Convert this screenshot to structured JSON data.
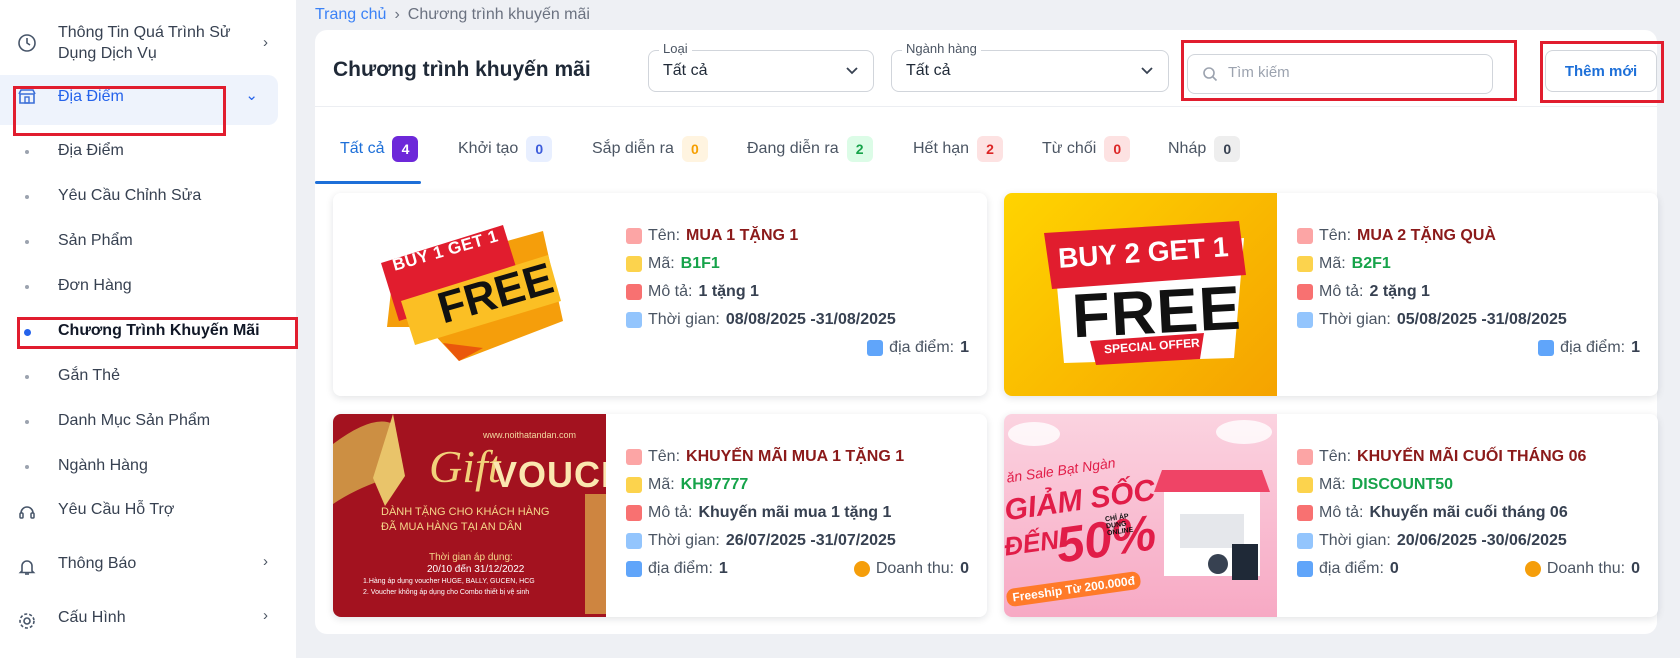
{
  "sidebar": {
    "items": [
      {
        "label_line1": "Thông Tin Quá Trình Sử",
        "label_line2": "Dụng Dịch Vụ",
        "icon": "clock-icon"
      },
      {
        "label": "Địa Điểm",
        "icon": "store-icon"
      },
      {
        "label": "Địa Điểm"
      },
      {
        "label": "Yêu Cầu Chỉnh Sửa"
      },
      {
        "label": "Sản Phẩm"
      },
      {
        "label": "Đơn Hàng"
      },
      {
        "label": "Chương Trình Khuyến Mãi"
      },
      {
        "label": "Gắn Thẻ"
      },
      {
        "label": "Danh Mục Sản Phẩm"
      },
      {
        "label": "Ngành Hàng"
      },
      {
        "label": "Yêu Cầu Hỗ Trợ",
        "icon": "headset-icon"
      },
      {
        "label": "Thông Báo",
        "icon": "bell-icon"
      },
      {
        "label": "Cấu Hình",
        "icon": "gear-icon"
      }
    ]
  },
  "breadcrumb": {
    "home": "Trang chủ",
    "separator": "›",
    "current": "Chương trình khuyến mãi"
  },
  "header": {
    "title": "Chương trình khuyến mãi",
    "type_filter": {
      "label": "Loại",
      "value": "Tất cả"
    },
    "industry_filter": {
      "label": "Ngành hàng",
      "value": "Tất cả"
    },
    "search_placeholder": "Tìm kiếm",
    "add_label": "Thêm mới"
  },
  "tabs": [
    {
      "label": "Tất cả",
      "count": "4",
      "badge_bg": "#6d28d9",
      "badge_fg": "#ffffff"
    },
    {
      "label": "Khởi tạo",
      "count": "0",
      "badge_bg": "#e8efff",
      "badge_fg": "#3b5bdb"
    },
    {
      "label": "Sắp diễn ra",
      "count": "0",
      "badge_bg": "#fff4e0",
      "badge_fg": "#f59f00"
    },
    {
      "label": "Đang diễn ra",
      "count": "2",
      "badge_bg": "#dcfce7",
      "badge_fg": "#16a34a"
    },
    {
      "label": "Hết hạn",
      "count": "2",
      "badge_bg": "#fde2e2",
      "badge_fg": "#dc2626"
    },
    {
      "label": "Từ chối",
      "count": "0",
      "badge_bg": "#fde2e2",
      "badge_fg": "#dc2626"
    },
    {
      "label": "Nháp",
      "count": "0",
      "badge_bg": "#eeeeee",
      "badge_fg": "#374151"
    }
  ],
  "labels": {
    "name": "Tên:",
    "code": "Mã:",
    "desc": "Mô tả:",
    "time": "Thời gian:",
    "location": "địa điểm:",
    "revenue": "Doanh thu:"
  },
  "promotions": [
    {
      "name": "MUA 1 TẶNG 1",
      "code": "B1F1",
      "desc": "1 tặng 1",
      "time": "08/08/2025 -31/08/2025",
      "locations": "1",
      "banner": {
        "line1": "BUY 1 GET 1",
        "line2": "FREE"
      }
    },
    {
      "name": "MUA 2 TẶNG QUÀ",
      "code": "B2F1",
      "desc": "2 tặng 1",
      "time": "05/08/2025 -31/08/2025",
      "locations": "1",
      "banner": {
        "line1": "BUY 2 GET 1",
        "line2": "FREE",
        "line3": "SPECIAL OFFER"
      }
    },
    {
      "name": "KHUYẾN MÃI MUA 1 TẶNG 1",
      "code": "KH97777",
      "desc": "Khuyến mãi mua 1 tặng 1",
      "time": "26/07/2025 -31/07/2025",
      "locations": "1",
      "revenue": "0",
      "banner": {
        "script": "Gift",
        "word": "VOUCH",
        "url": "www.noithatandan.com",
        "sub1": "DÀNH TẶNG CHO KHÁCH HÀNG",
        "sub2": "ĐÃ MUA HÀNG TẠI AN DÂN",
        "period_label": "Thời gian áp dụng:",
        "period": "20/10 đến 31/12/2022",
        "note1": "1.Hàng áp dụng voucher  HUGE, BALLY, GUCEN, HCG",
        "note2": "2. Voucher không áp dụng cho Combo thiết bị vệ sinh"
      }
    },
    {
      "name": "KHUYẾN MÃI CUỐI THÁNG 06",
      "code": "DISCOUNT50",
      "desc": "Khuyến mãi cuối tháng 06",
      "time": "20/06/2025 -30/06/2025",
      "locations": "0",
      "revenue": "0",
      "banner": {
        "top": "ăn Sale Bạt Ngàn",
        "line1": "GIẢM SỐC",
        "line2": "ĐẾN",
        "pct": "50%",
        "online": "CHỈ ÁP DỤNG ONLINE",
        "ship": "Freeship Từ 200.000đ"
      }
    }
  ]
}
